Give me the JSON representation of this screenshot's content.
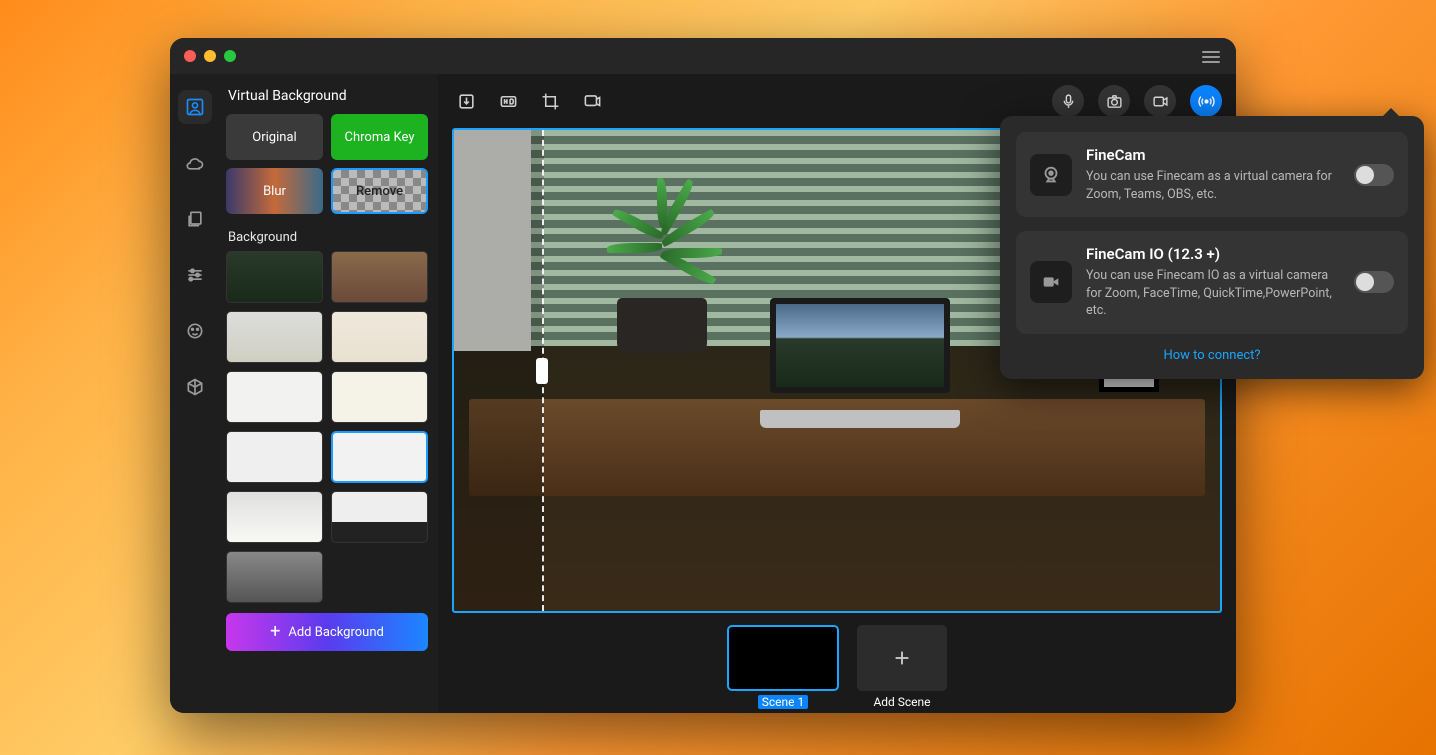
{
  "window": {
    "menu_label": "menu"
  },
  "sidebar": {
    "panel_title": "Virtual Background",
    "modes": {
      "original": "Original",
      "chroma": "Chroma Key",
      "blur": "Blur",
      "remove": "Remove"
    },
    "section_label": "Background",
    "add_button": "Add Background"
  },
  "scenes": {
    "scene1_label": "Scene 1",
    "add_label": "Add Scene"
  },
  "popover": {
    "cards": [
      {
        "title": "FineCam",
        "desc": "You can use Finecam as a virtual camera for Zoom, Teams, OBS, etc."
      },
      {
        "title": "FineCam IO (12.3 +)",
        "desc": "You can use Finecam IO as a virtual camera for Zoom, FaceTime, QuickTime,PowerPoint, etc."
      }
    ],
    "link": "How to connect?"
  }
}
